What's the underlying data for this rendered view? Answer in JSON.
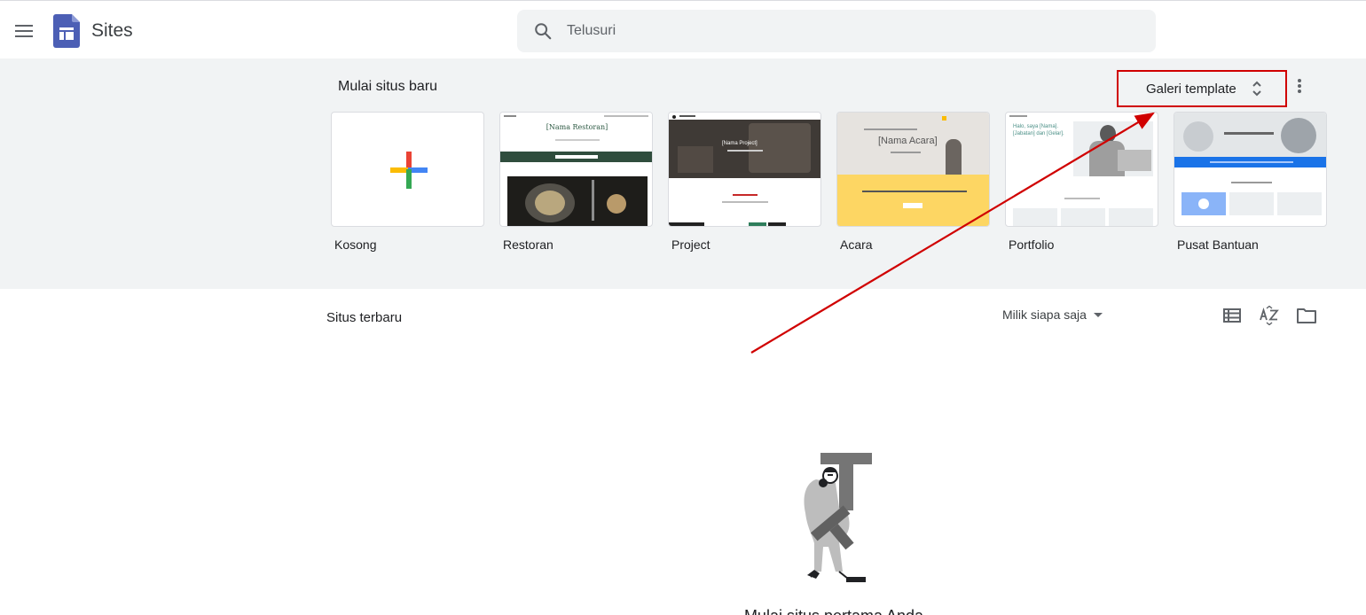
{
  "app": {
    "name": "Sites",
    "brand_color": "#3f51b5"
  },
  "search": {
    "placeholder": "Telusuri"
  },
  "gallery": {
    "title": "Mulai situs baru",
    "toggle_label": "Galeri template",
    "templates": [
      {
        "label": "Kosong"
      },
      {
        "label": "Restoran",
        "thumb_heading": "[Nama Restoran]"
      },
      {
        "label": "Project",
        "thumb_heading": "[Nama Project]"
      },
      {
        "label": "Acara",
        "thumb_heading": "[Nama Acara]"
      },
      {
        "label": "Portfolio",
        "thumb_heading": "Halo, saya [Nama]. [Jabatan] dan [Gelar]."
      },
      {
        "label": "Pusat Bantuan"
      }
    ]
  },
  "recent": {
    "title": "Situs terbaru",
    "owner_filter": "Milik siapa saja"
  },
  "empty_state": {
    "text": "Mulai situs pertama Anda"
  },
  "annotation": {
    "highlight_color": "#d00000"
  }
}
